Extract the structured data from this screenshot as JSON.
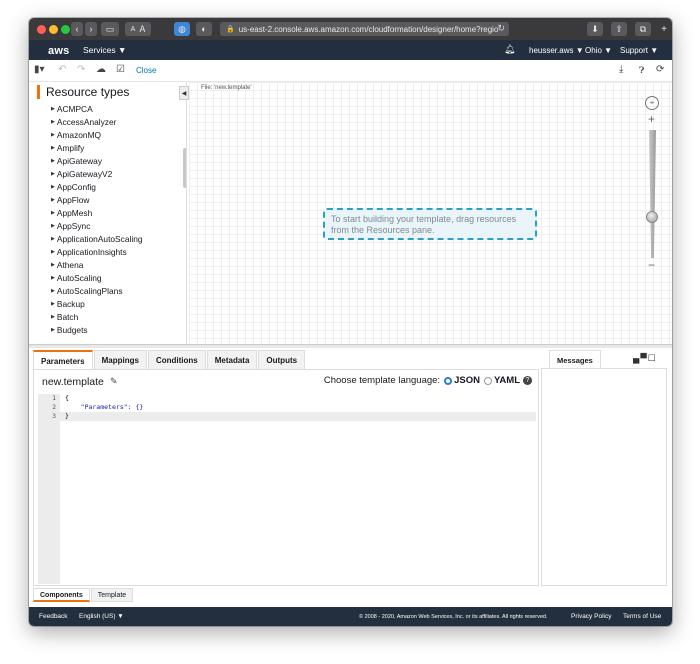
{
  "browser": {
    "url": "us-east-2.console.aws.amazon.com/cloudformation/designer/home?regio",
    "zoom_small": "A",
    "zoom_large": "A"
  },
  "aws_nav": {
    "logo": "aws",
    "services": "Services ▼",
    "account": "heusser.aws ▼",
    "region": "Ohio ▼",
    "support": "Support ▼"
  },
  "toolbar": {
    "close": "Close"
  },
  "resources": {
    "title": "Resource types",
    "items": [
      "ACMPCA",
      "AccessAnalyzer",
      "AmazonMQ",
      "Amplify",
      "ApiGateway",
      "ApiGatewayV2",
      "AppConfig",
      "AppFlow",
      "AppMesh",
      "AppSync",
      "ApplicationAutoScaling",
      "ApplicationInsights",
      "Athena",
      "AutoScaling",
      "AutoScalingPlans",
      "Backup",
      "Batch",
      "Budgets"
    ]
  },
  "canvas": {
    "file_label": "File: 'new.template'",
    "hint": "To start building your template, drag resources from the Resources pane."
  },
  "editor": {
    "tabs": [
      "Parameters",
      "Mappings",
      "Conditions",
      "Metadata",
      "Outputs"
    ],
    "template_name": "new.template",
    "language_prompt": "Choose template language:",
    "language_json": "JSON",
    "language_yaml": "YAML",
    "code_lines": [
      {
        "num": "1",
        "text": "{"
      },
      {
        "num": "2",
        "text": "    \"Parameters\": {}"
      },
      {
        "num": "3",
        "text": "}"
      }
    ]
  },
  "messages": {
    "tab": "Messages"
  },
  "bottom_tabs": [
    "Components",
    "Template"
  ],
  "footer": {
    "feedback": "Feedback",
    "language": "English (US) ▼",
    "copyright": "© 2008 - 2020, Amazon Web Services, Inc. or its affiliates. All rights reserved.",
    "privacy": "Privacy Policy",
    "terms": "Terms of Use"
  },
  "colors": {
    "aws_nav": "#232f3e",
    "accent_orange": "#ec7211",
    "link_blue": "#0073bb",
    "hint_border": "#2c9fc6"
  }
}
